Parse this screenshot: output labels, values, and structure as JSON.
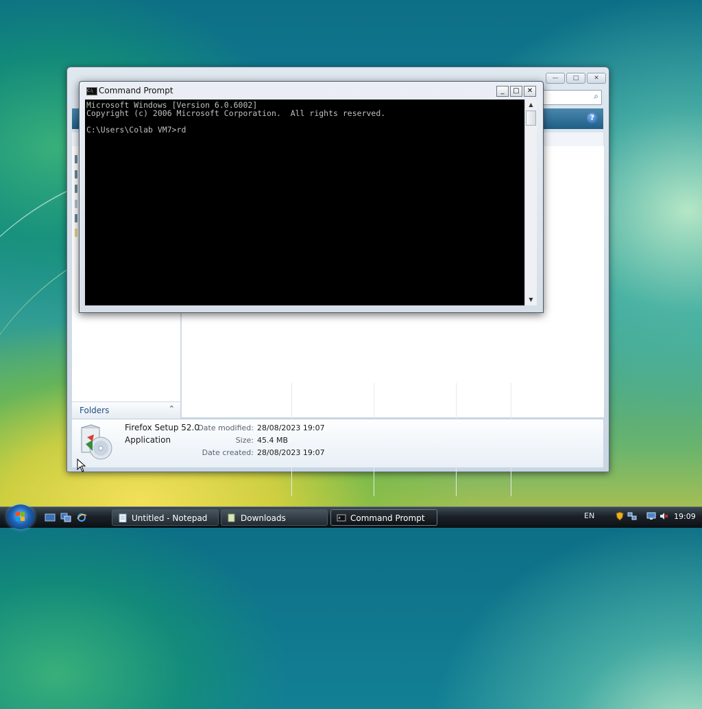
{
  "explorer": {
    "title": "Downloads",
    "controls": {
      "minimize": "—",
      "maximize": "□",
      "close": "✕"
    },
    "help_glyph": "?",
    "search_glyph": "⌕",
    "folders_label": "Folders",
    "folders_chevron": "⌃",
    "details": {
      "file_name": "Firefox Setup 52.0",
      "file_type": "Application",
      "date_modified_label": "Date modified:",
      "date_modified": "28/08/2023 19:07",
      "size_label": "Size:",
      "size": "45.4 MB",
      "date_created_label": "Date created:",
      "date_created": "28/08/2023 19:07"
    }
  },
  "cmd": {
    "title": "Command Prompt",
    "icon_text": "C:\\",
    "controls": {
      "minimize": "_",
      "maximize": "□",
      "close": "✕"
    },
    "console_text": "Microsoft Windows [Version 6.0.6002]\nCopyright (c) 2006 Microsoft Corporation.  All rights reserved.\n\nC:\\Users\\Colab VM7>rd",
    "scroll_up": "▲",
    "scroll_down": "▼"
  },
  "taskbar": {
    "buttons": [
      {
        "label": "Untitled - Notepad",
        "icon": "notepad-icon"
      },
      {
        "label": "Downloads",
        "icon": "folder-icon"
      },
      {
        "label": "Command Prompt",
        "icon": "cmd-icon",
        "active": true
      }
    ],
    "language": "EN",
    "clock": "19:09"
  },
  "colors": {
    "taskbar": "#1a2128",
    "console_bg": "#000000",
    "console_fg": "#c0c0c0",
    "explorer_toolbar": "#2f6f97"
  }
}
